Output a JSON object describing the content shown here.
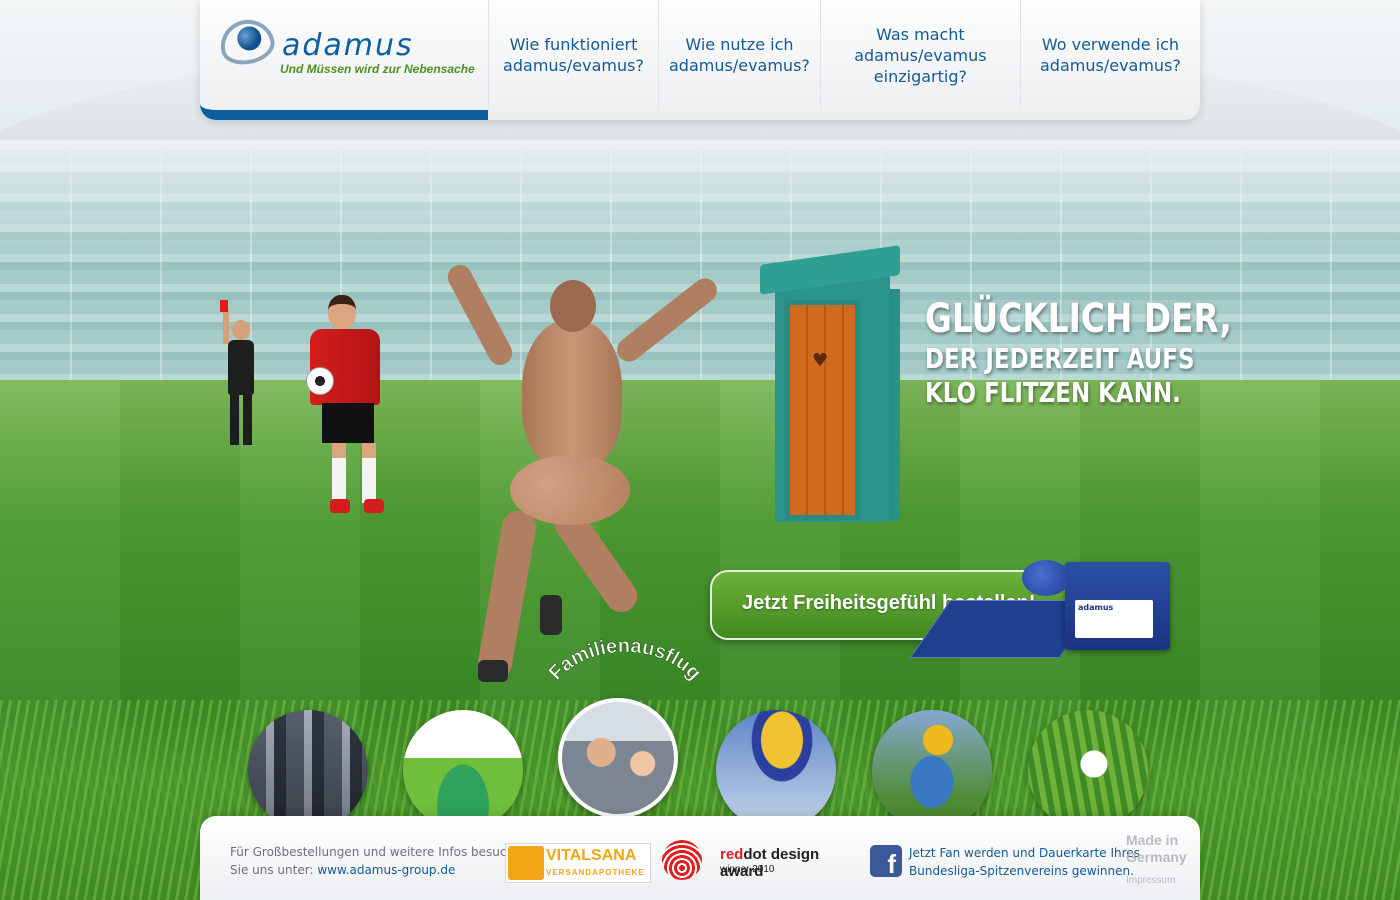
{
  "header": {
    "logo_wordmark": "adamus",
    "logo_tagline": "Und Müssen wird zur Nebensache",
    "nav": [
      {
        "label": "Wie funktioniert\nadamus/evamus?"
      },
      {
        "label": "Wie nutze ich\nadamus/evamus?"
      },
      {
        "label": "Was macht\nadamus/evamus\neinzigartig?"
      },
      {
        "label": "Wo verwende ich\nadamus/evamus?"
      }
    ],
    "accent_color": "#0e5fa0"
  },
  "headline": {
    "line1": "GLÜCKLICH DER,",
    "line2": "DER JEDERZEIT AUFS",
    "line3": "KLO FLITZEN KANN."
  },
  "cta": {
    "label": "Jetzt Freiheitsgefühl bestellen!",
    "color": "#4f9c2a"
  },
  "product": {
    "box_label": "adamus"
  },
  "thumbnails": {
    "active_caption": "Familienausflug",
    "items": [
      {
        "icon": "traffic-jam-image"
      },
      {
        "icon": "tent-camping-image"
      },
      {
        "icon": "family-car-image"
      },
      {
        "icon": "hot-air-balloon-image"
      },
      {
        "icon": "construction-worker-image"
      },
      {
        "icon": "cornfield-image"
      }
    ]
  },
  "footer": {
    "info_line1": "Für Großbestellungen und weitere Infos besuchen",
    "info_line2_prefix": "Sie uns unter:",
    "info_link": "www.adamus-group.de",
    "vitalsana_name": "VITALSANA",
    "vitalsana_sub": "VERSANDAPOTHEKE",
    "reddot_red": "red",
    "reddot_rest": "dot design award",
    "reddot_sub": "winner 2010",
    "facebook_line1": "Jetzt Fan werden und Dauerkarte Ihres",
    "facebook_line2": "Bundesliga-Spitzenvereins gewinnen.",
    "made_in_line1": "Made in",
    "made_in_line2": "Germany",
    "impressum": "Impressum"
  }
}
